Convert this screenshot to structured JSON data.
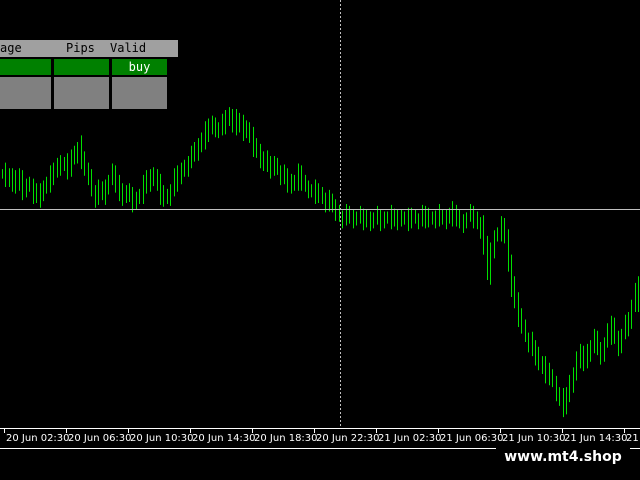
{
  "signal_panel": {
    "headers": [
      "age",
      "Pips",
      "Valid"
    ],
    "rows": [
      {
        "cells": [
          "",
          "",
          "buy"
        ],
        "colors": [
          "#008000",
          "#008000",
          "#008000"
        ]
      },
      {
        "cells": [
          "",
          "",
          ""
        ],
        "colors": [
          "#808080",
          "#808080",
          "#808080"
        ]
      },
      {
        "cells": [
          "",
          "",
          ""
        ],
        "colors": [
          "#808080",
          "#808080",
          "#808080"
        ]
      }
    ]
  },
  "time_axis": {
    "labels": [
      "20 Jun 02:30",
      "20 Jun 06:30",
      "20 Jun 10:30",
      "20 Jun 14:30",
      "20 Jun 18:30",
      "20 Jun 22:30",
      "21 Jun 02:30",
      "21 Jun 06:30",
      "21 Jun 10:30",
      "21 Jun 14:30",
      "21 Jun 1"
    ]
  },
  "watermark": "www.mt4.shop",
  "colors": {
    "background": "#000000",
    "candles": "#00e000",
    "grid_text": "#ffffff",
    "crosshair": "#c0c0c0",
    "buy_cell": "#008000",
    "empty_cell": "#808080",
    "header": "#a0a0a0"
  },
  "chart_data": {
    "type": "candlestick",
    "symbol_pair_visible": false,
    "price_series": [
      62,
      58,
      55,
      60,
      50,
      55,
      45,
      48,
      52,
      40,
      38,
      42,
      47,
      53,
      58,
      63,
      70,
      75,
      72,
      68,
      78,
      84,
      90,
      75,
      65,
      60,
      45,
      38,
      44,
      40,
      48,
      55,
      60,
      52,
      40,
      45,
      40,
      38,
      32,
      35,
      40,
      48,
      55,
      58,
      62,
      50,
      40,
      35,
      38,
      45,
      55,
      60,
      65,
      70,
      76,
      80,
      86,
      92,
      100,
      105,
      110,
      115,
      112,
      108,
      114,
      120,
      125,
      118,
      112,
      116,
      108,
      112,
      100,
      90,
      86,
      80,
      74,
      70,
      68,
      72,
      66,
      60,
      58,
      54,
      50,
      55,
      60,
      52,
      48,
      46,
      44,
      42,
      40,
      36,
      32,
      30,
      26,
      22,
      18,
      16,
      18,
      15,
      16,
      15,
      14,
      12,
      15,
      13,
      16,
      14,
      12,
      14,
      16,
      13,
      14,
      15,
      17,
      14,
      12,
      16,
      14,
      13,
      16,
      17,
      14,
      15,
      18,
      14,
      13,
      16,
      20,
      18,
      15,
      10,
      12,
      16,
      18,
      14,
      10,
      5,
      -15,
      -45,
      -20,
      -5,
      0,
      5,
      -5,
      -30,
      -60,
      -75,
      -90,
      -100,
      -112,
      -118,
      -125,
      -130,
      -138,
      -145,
      -150,
      -155,
      -160,
      -170,
      -178,
      -185,
      -175,
      -160,
      -150,
      -140,
      -130,
      -138,
      -126,
      -120,
      -115,
      -125,
      -130,
      -118,
      -110,
      -100,
      -112,
      -120,
      -108,
      -100,
      -95,
      -80,
      -60,
      -75
    ]
  }
}
